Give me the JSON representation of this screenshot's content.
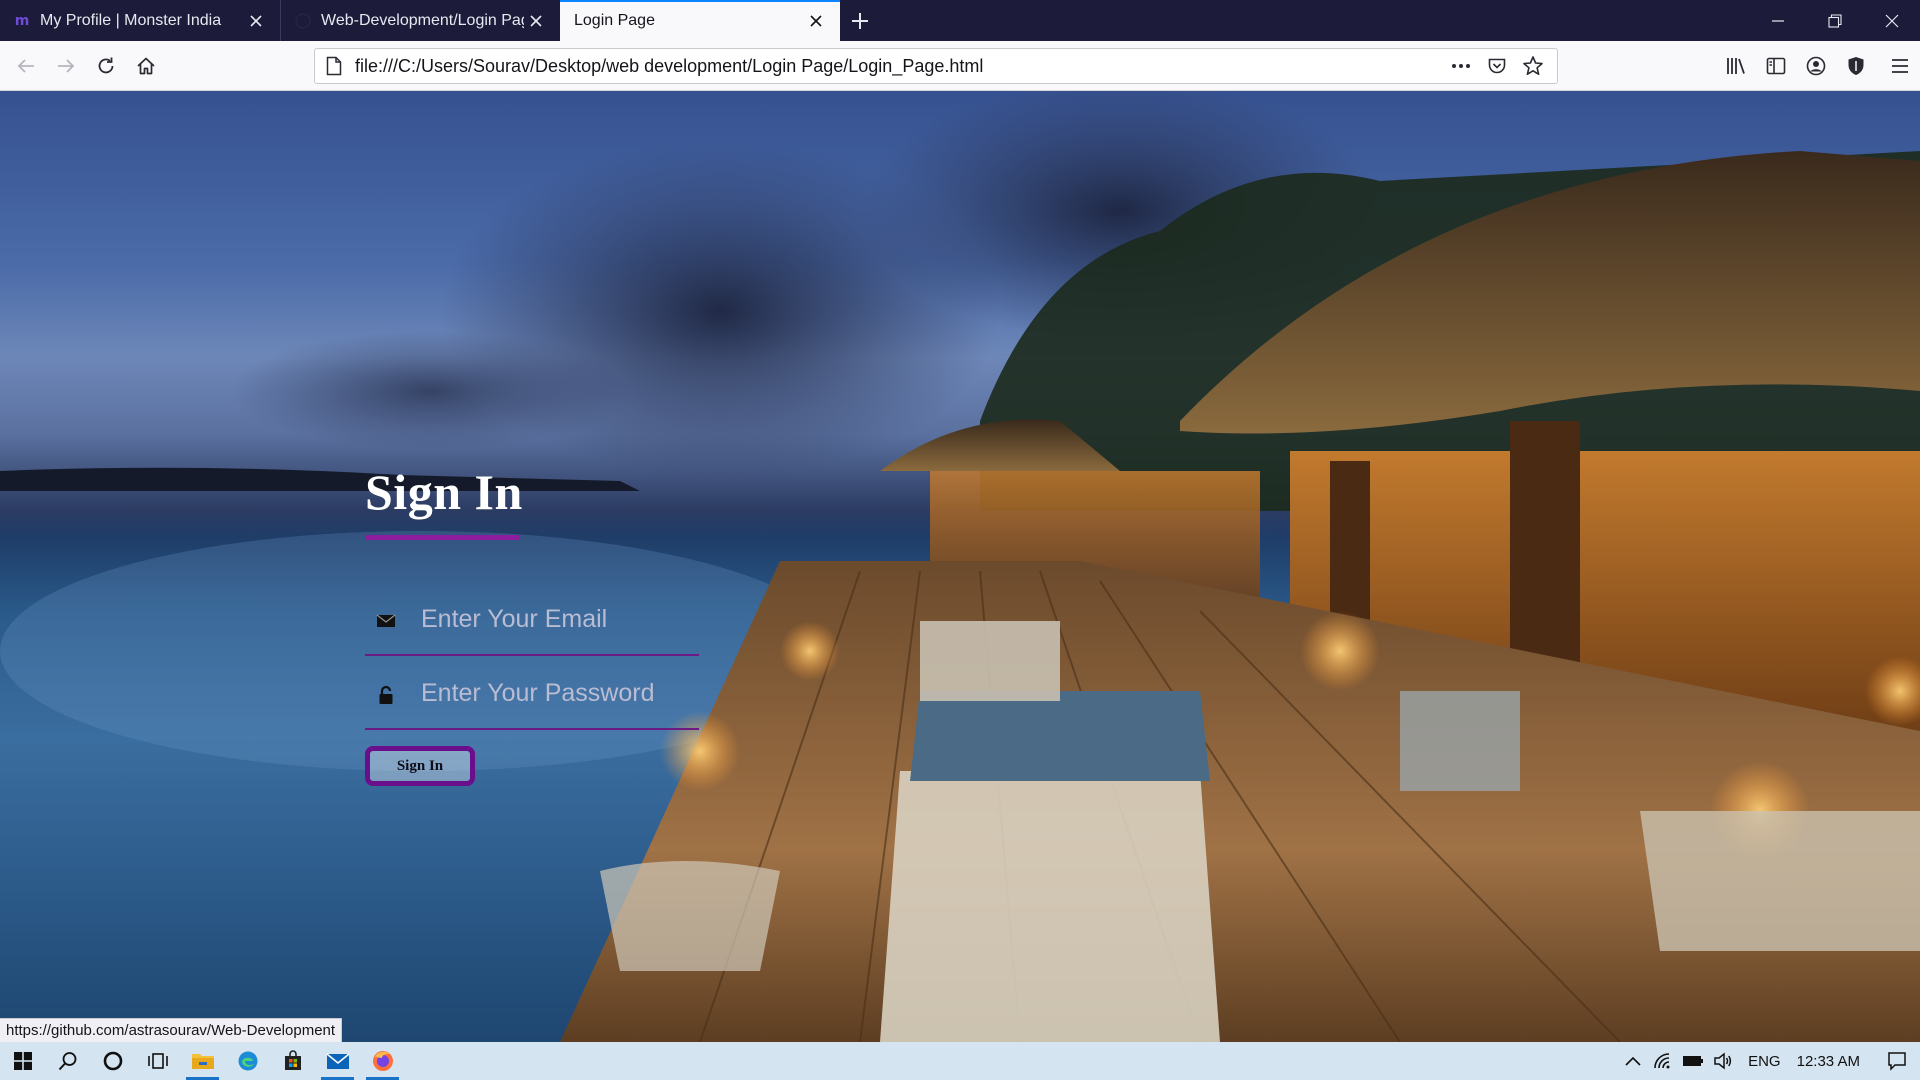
{
  "browser": {
    "tabs": [
      {
        "title": "My Profile | Monster India",
        "favicon": "monster-icon",
        "active": false
      },
      {
        "title": "Web-Development/Login Page",
        "favicon": "github-icon",
        "active": false
      },
      {
        "title": "Login Page",
        "favicon": "",
        "active": true
      }
    ],
    "url": "file:///C:/Users/Sourav/Desktop/web development/Login Page/Login_Page.html",
    "accent_color": "#0a84ff"
  },
  "login": {
    "heading": "Sign In",
    "email_placeholder": "Enter Your Email",
    "password_placeholder": "Enter Your Password",
    "button_label": "Sign In",
    "accent_color": "#6a0f8c"
  },
  "status": {
    "link_preview": "https://github.com/astrasourav/Web-Development"
  },
  "taskbar": {
    "items": [
      "windows-start-icon",
      "search-icon",
      "cortana-icon",
      "task-view-icon",
      "file-explorer-icon",
      "edge-icon",
      "store-icon",
      "mail-icon",
      "firefox-icon"
    ],
    "language": "ENG",
    "time": "12:33 AM"
  }
}
